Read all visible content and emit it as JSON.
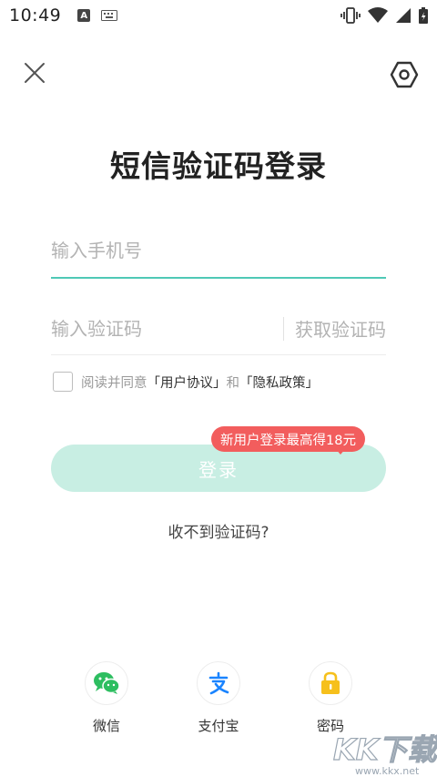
{
  "status_bar": {
    "time": "10:49",
    "notif_a": "A"
  },
  "page": {
    "title": "短信验证码登录"
  },
  "form": {
    "phone_placeholder": "输入手机号",
    "code_placeholder": "输入验证码",
    "get_code_label": "获取验证码",
    "agreement_prefix": "阅读并同意",
    "user_agreement": "「用户协议」",
    "and": "和",
    "privacy_policy": "「隐私政策」",
    "login_label": "登录",
    "promo_badge": "新用户登录最高得18元",
    "no_code_link": "收不到验证码?"
  },
  "third_party": [
    {
      "label": "微信",
      "icon": "wechat-icon",
      "color": "#2dbe60"
    },
    {
      "label": "支付宝",
      "icon": "alipay-icon",
      "color": "#1a84ff"
    },
    {
      "label": "密码",
      "icon": "lock-icon",
      "color": "#f6c01c"
    }
  ],
  "watermark": {
    "brand": "KK下载",
    "url": "www.kkx.net"
  },
  "colors": {
    "accent": "#4fc9b6",
    "login_bg": "#c8eee3",
    "promo": "#f25d5d"
  }
}
